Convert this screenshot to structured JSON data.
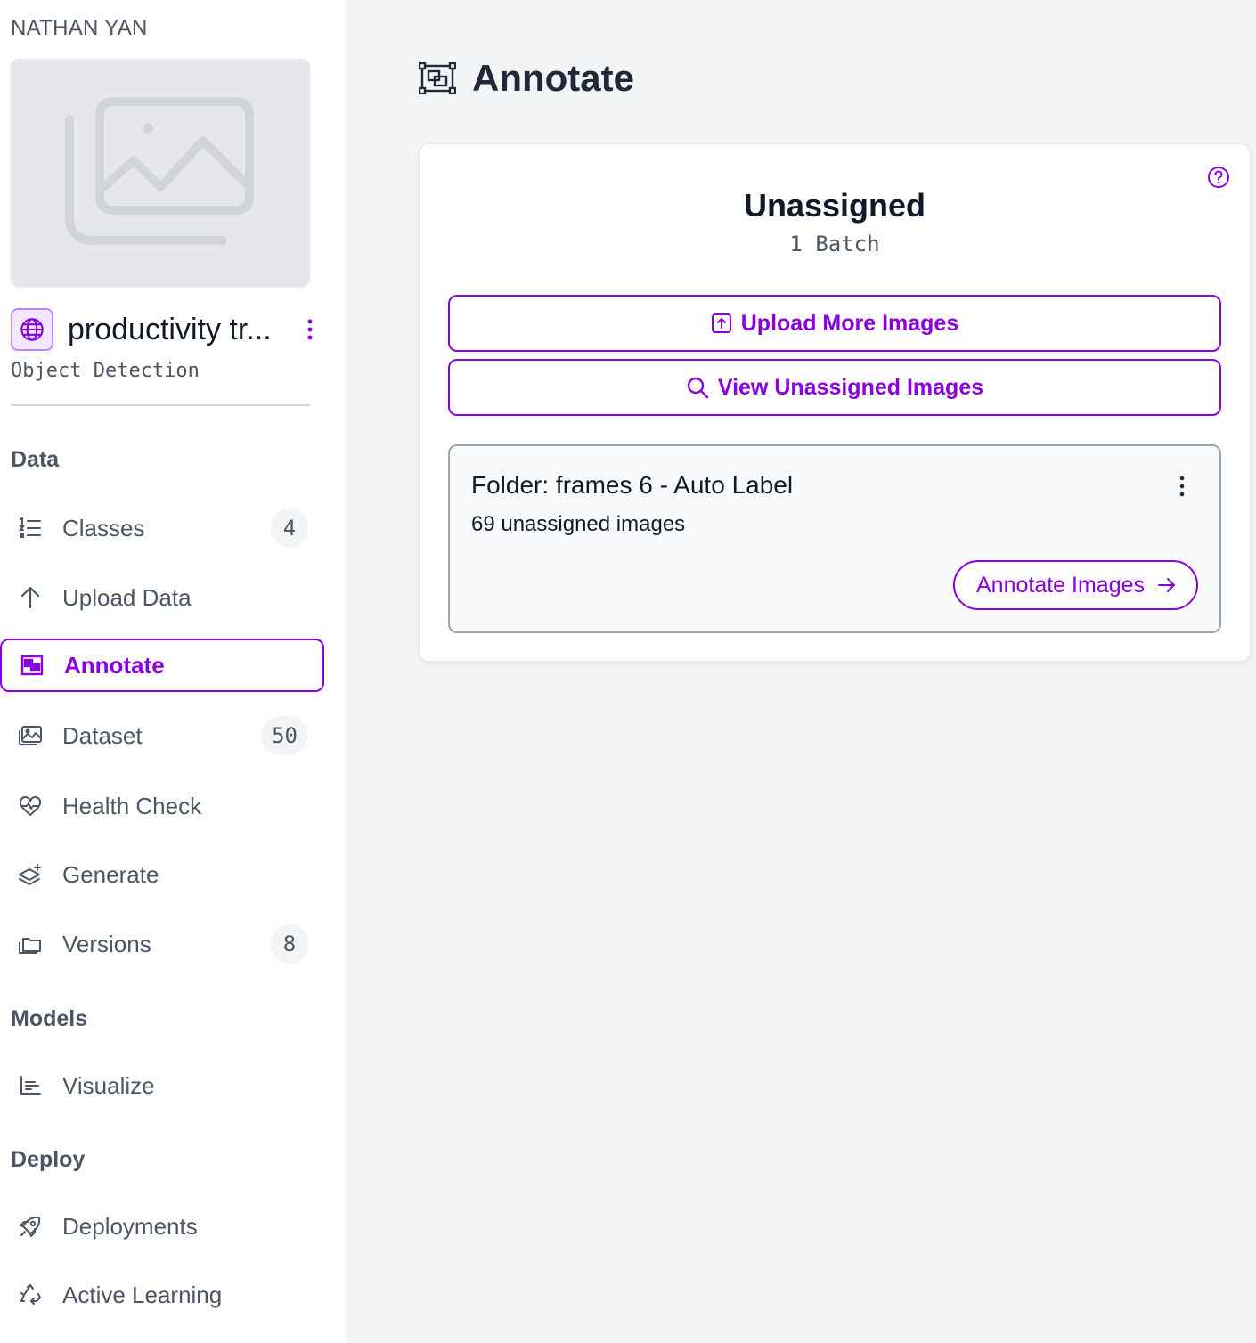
{
  "sidebar": {
    "workspace_name": "NATHAN YAN",
    "project": {
      "name": "productivity tr...",
      "type": "Object Detection"
    },
    "sections": {
      "data": "Data",
      "models": "Models",
      "deploy": "Deploy"
    },
    "items": {
      "classes": {
        "label": "Classes",
        "count": "4",
        "icon": "list-ordered-icon"
      },
      "upload": {
        "label": "Upload Data",
        "icon": "arrow-up-icon"
      },
      "annotate": {
        "label": "Annotate",
        "icon": "annotate-icon",
        "active": true
      },
      "dataset": {
        "label": "Dataset",
        "count": "50",
        "icon": "images-icon"
      },
      "health": {
        "label": "Health Check",
        "icon": "heart-pulse-icon"
      },
      "generate": {
        "label": "Generate",
        "icon": "layers-sparkle-icon"
      },
      "versions": {
        "label": "Versions",
        "count": "8",
        "icon": "folder-stack-icon"
      },
      "visualize": {
        "label": "Visualize",
        "icon": "bar-chart-icon"
      },
      "deployments": {
        "label": "Deployments",
        "icon": "rocket-icon"
      },
      "active_learning": {
        "label": "Active Learning",
        "icon": "recycle-icon"
      }
    }
  },
  "main": {
    "title": "Annotate",
    "card": {
      "title": "Unassigned",
      "subtitle": "1 Batch",
      "upload_more_label": "Upload More Images",
      "view_unassigned_label": "View Unassigned Images",
      "folder": {
        "title": "Folder: frames 6 - Auto Label",
        "count": "69 unassigned images",
        "annotate_label": "Annotate Images"
      }
    }
  },
  "colors": {
    "accent": "#8b00e0",
    "text_muted": "#4b5563",
    "background": "#f3f4f6"
  }
}
